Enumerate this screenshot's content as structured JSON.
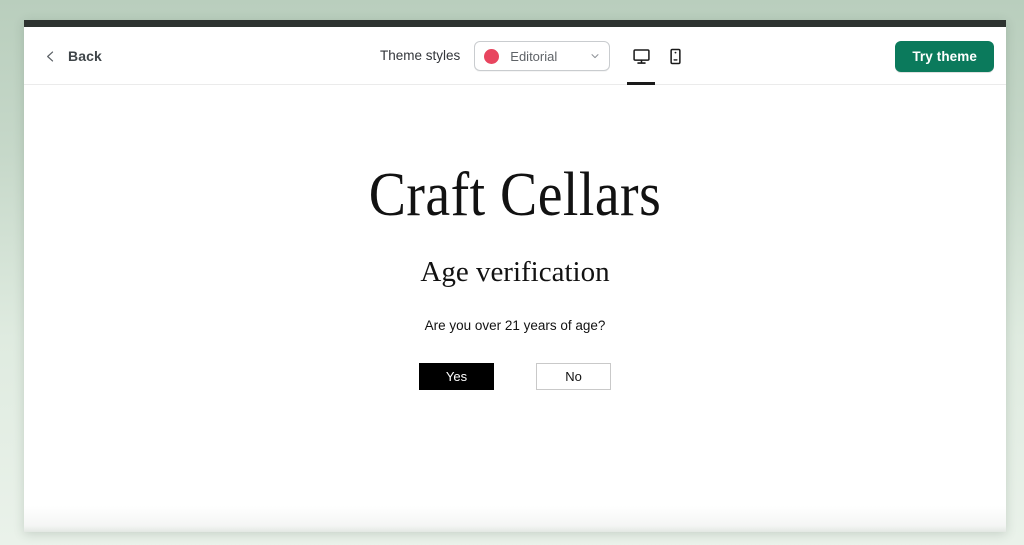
{
  "window": {
    "topbar_color": "#2e3330",
    "background_top_color": "#b9cebd",
    "background_bottom_color": "#eaf2ea"
  },
  "header": {
    "back": {
      "label": "Back",
      "icon": "chevron-left-icon"
    },
    "theme_styles": {
      "label": "Theme styles",
      "selected_style": "Editorial",
      "swatch_color": "#e8455f",
      "dropdown_icon": "chevron-down-icon"
    },
    "device_toggles": [
      {
        "name": "desktop",
        "icon": "desktop-icon",
        "active": true
      },
      {
        "name": "mobile",
        "icon": "mobile-icon",
        "active": false
      }
    ],
    "try_theme": {
      "label": "Try theme",
      "color": "#0b7a5c"
    }
  },
  "preview": {
    "shop_name": "Craft Cellars",
    "age_gate": {
      "title": "Age verification",
      "question": "Are you over 21 years of age?",
      "confirm_label": "Yes",
      "decline_label": "No",
      "confirm_background": "#000000",
      "decline_background": "#ffffff"
    }
  }
}
